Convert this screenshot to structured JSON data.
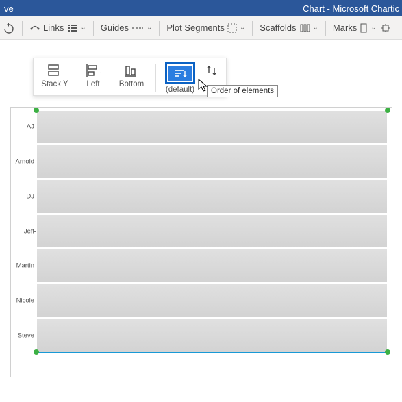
{
  "titlebar": {
    "left": "ve",
    "center": "Chart - Microsoft Chartic"
  },
  "ribbon": {
    "links": "Links",
    "guides": "Guides",
    "plotSegments": "Plot Segments",
    "scaffolds": "Scaffolds",
    "marks": "Marks"
  },
  "floatToolbar": {
    "stackY": "Stack Y",
    "left": "Left",
    "bottom": "Bottom",
    "default": "(default)"
  },
  "tooltip": "Order of elements",
  "chart_data": {
    "type": "bar",
    "title": "",
    "xlabel": "",
    "ylabel": "",
    "categories": [
      "AJ",
      "Arnold",
      "DJ",
      "Jeff",
      "Martin",
      "Nicole",
      "Steve"
    ],
    "values": [
      1,
      1,
      1,
      1,
      1,
      1,
      1
    ],
    "ylim": [
      0,
      1
    ]
  }
}
